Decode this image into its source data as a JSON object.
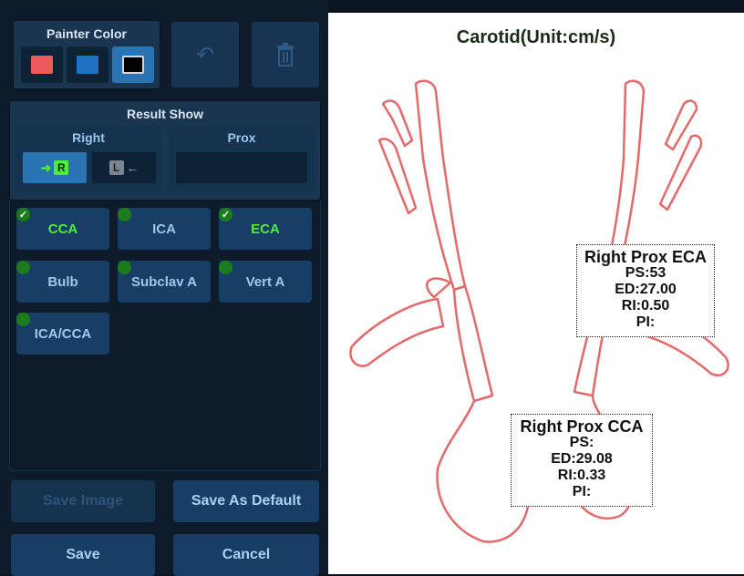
{
  "painter": {
    "title": "Painter Color",
    "colors": [
      "#ef5a5a",
      "#1f72c2",
      "#000000"
    ],
    "undo_icon": "undo-icon",
    "delete_icon": "trash-icon"
  },
  "result_show": {
    "title": "Result Show",
    "side": {
      "title": "Right",
      "right_label": "R",
      "left_label": "L"
    },
    "position": {
      "title": "Prox"
    }
  },
  "vessels": [
    {
      "label": "CCA",
      "checked": true
    },
    {
      "label": "ICA",
      "checked": false
    },
    {
      "label": "ECA",
      "checked": true
    },
    {
      "label": "Bulb",
      "checked": false
    },
    {
      "label": "Subclav A",
      "checked": false
    },
    {
      "label": "Vert A",
      "checked": false
    },
    {
      "label": "ICA/CCA",
      "checked": false
    }
  ],
  "buttons": {
    "save_image": "Save Image",
    "save_default": "Save As Default",
    "save": "Save",
    "cancel": "Cancel"
  },
  "canvas": {
    "title": "Carotid(Unit:cm/s)",
    "stroke_color": "#e36a6a",
    "eca": {
      "title": "Right Prox ECA",
      "ps": "PS:53",
      "ed": "ED:27.00",
      "ri": "RI:0.50",
      "pi": "PI:"
    },
    "cca": {
      "title": "Right Prox CCA",
      "ps": "PS:",
      "ed": "ED:29.08",
      "ri": "RI:0.33",
      "pi": "PI:"
    }
  }
}
